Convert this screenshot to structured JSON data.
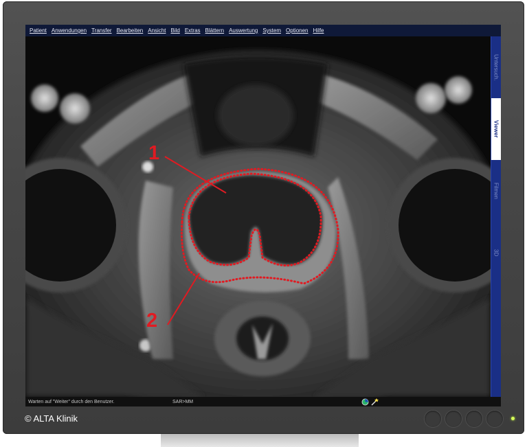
{
  "menu": [
    "Patient",
    "Anwendungen",
    "Transfer",
    "Bearbeiten",
    "Ansicht",
    "Bild",
    "Extras",
    "Blättern",
    "Auswertung",
    "System",
    "Optionen",
    "Hilfe"
  ],
  "side_tabs": [
    {
      "label": "Untersuch.",
      "state": "dim"
    },
    {
      "label": "Viewer",
      "state": "active"
    },
    {
      "label": "Filmen",
      "state": "dim"
    },
    {
      "label": "3D",
      "state": "dim"
    }
  ],
  "status": {
    "message": "Warten auf \"Weiter\" durch den Benutzer.",
    "user": "SAR>MM"
  },
  "annotations": {
    "label_1": "1",
    "label_2": "2",
    "color": "#e01b22"
  },
  "watermark": "© ALTA Klinik",
  "led_color": "#d8ff5a"
}
